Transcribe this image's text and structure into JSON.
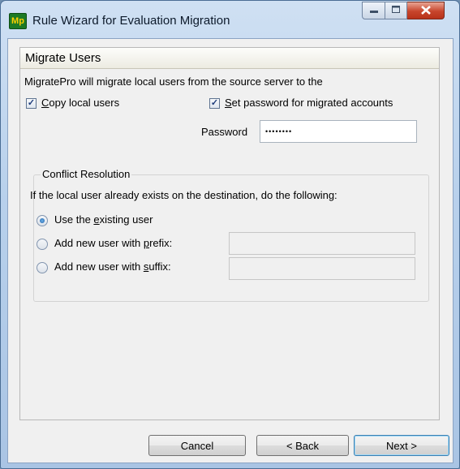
{
  "window": {
    "title": "Rule Wizard for Evaluation Migration",
    "app_icon_text": "Mp",
    "controls": {
      "minimize_icon": "minimize-icon",
      "maximize_icon": "maximize-icon",
      "close_icon": "close-icon"
    }
  },
  "panel": {
    "title": "Migrate Users",
    "description": "MigratePro will migrate local users from the source server to the",
    "copy_local_users": {
      "label_pre": "",
      "label_mnemonic": "C",
      "label_post": "opy local users",
      "checked": true
    },
    "set_password": {
      "label_pre": "",
      "label_mnemonic": "S",
      "label_post": "et password for migrated accounts",
      "checked": true
    },
    "password": {
      "label": "Password",
      "value": "••••••••"
    },
    "conflict": {
      "title": "Conflict Resolution",
      "instruction": "If the local user already exists on the destination, do the following:",
      "options": [
        {
          "label_pre": "Use the ",
          "label_mnemonic": "e",
          "label_post": "xisting user",
          "selected": true
        },
        {
          "label_pre": "Add new user with ",
          "label_mnemonic": "p",
          "label_post": "refix:",
          "selected": false
        },
        {
          "label_pre": "Add new user with ",
          "label_mnemonic": "s",
          "label_post": "uffix:",
          "selected": false
        }
      ],
      "prefix_value": "",
      "suffix_value": ""
    }
  },
  "buttons": {
    "cancel": "Cancel",
    "back": "< Back",
    "next": "Next >"
  },
  "colors": {
    "accent": "#3c7fb1",
    "titlebar": "#b9d1ec",
    "close": "#c7452c"
  }
}
